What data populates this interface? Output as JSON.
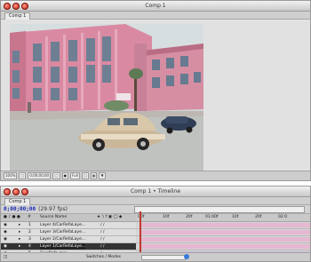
{
  "comp_window": {
    "title": "Comp 1",
    "tab": "Comp 1",
    "controls": [
      "100%",
      "0;00;00;00",
      "Full"
    ]
  },
  "timeline_window": {
    "title": "Comp 1 • Timeline",
    "tab": "Comp 1",
    "timecode": "0;00;00;00",
    "fps": "(29.97 fps)",
    "source_name_header": "Source Name",
    "ruler_ticks": [
      "00f",
      "10f",
      "20f",
      "01:00f",
      "10f",
      "20f",
      "02:0"
    ],
    "layers": [
      {
        "num": "1",
        "name": "Layer 4/CarRefaLaye..."
      },
      {
        "num": "2",
        "name": "Layer 3/CarRefaLaye..."
      },
      {
        "num": "3",
        "name": "Layer 2/CarRefaLaye..."
      },
      {
        "num": "4",
        "name": "Layer 1/CarRefaLaye...",
        "selected": true
      },
      {
        "num": "5",
        "name": "CarsRefo.mov"
      }
    ],
    "bottom_label": "Switches / Modes"
  }
}
